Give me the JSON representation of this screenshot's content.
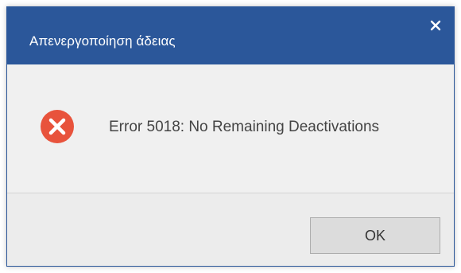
{
  "dialog": {
    "title": "Απενεργοποίηση άδειας",
    "close_icon": "close-icon",
    "error_icon": "error-icon",
    "message": "Error 5018: No Remaining Deactivations",
    "ok_label": "OK"
  },
  "colors": {
    "titlebar": "#2b579a",
    "error_red": "#e8533c",
    "body_bg": "#f0f0f0",
    "button_bg": "#dcdcdc"
  }
}
